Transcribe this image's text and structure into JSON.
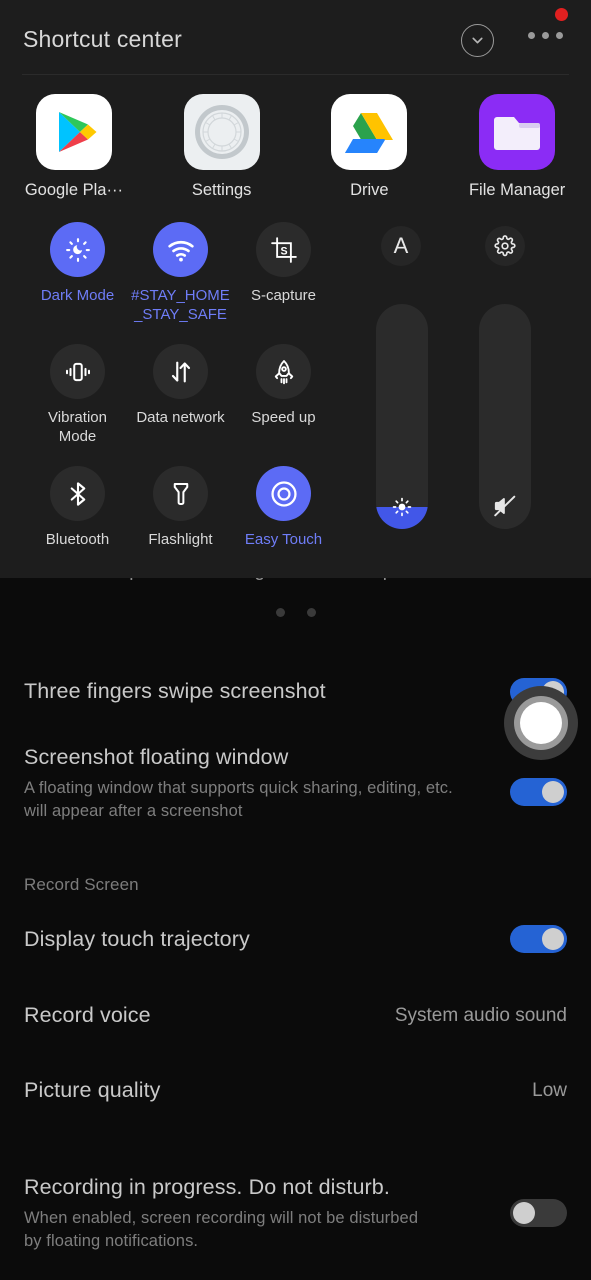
{
  "panel": {
    "title": "Shortcut center",
    "collapse_icon": "chevron-down-icon",
    "more_icon": "more-options-icon",
    "recording_indicator": "recording-dot",
    "apps": [
      {
        "label": "Google Pla···",
        "icon": "google-play-icon"
      },
      {
        "label": "Settings",
        "icon": "settings-gear-icon"
      },
      {
        "label": "Drive",
        "icon": "google-drive-icon"
      },
      {
        "label": "File Manager",
        "icon": "file-manager-folder-icon"
      }
    ],
    "tiles": [
      {
        "label": "Dark Mode",
        "icon": "dark-mode-icon",
        "active": true
      },
      {
        "label": "#STAY_HOME\n_STAY_SAFE",
        "icon": "wifi-icon",
        "active": true
      },
      {
        "label": "S-capture",
        "icon": "s-capture-crop-icon",
        "active": false
      },
      {
        "label": "Vibration\nMode",
        "icon": "vibration-icon",
        "active": false
      },
      {
        "label": "Data network",
        "icon": "data-network-arrows-icon",
        "active": false
      },
      {
        "label": "Speed up",
        "icon": "rocket-icon",
        "active": false
      },
      {
        "label": "Bluetooth",
        "icon": "bluetooth-icon",
        "active": false
      },
      {
        "label": "Flashlight",
        "icon": "flashlight-icon",
        "active": false
      },
      {
        "label": "Easy Touch",
        "icon": "easy-touch-circle-icon",
        "active": true
      }
    ],
    "auto_brightness_button": "A",
    "settings_button_icon": "gear-icon",
    "brightness_slider": {
      "icon": "brightness-icon",
      "percent": 10
    },
    "volume_slider": {
      "icon": "volume-muted-icon",
      "percent": 0
    },
    "accent_color": "#5C6BF5",
    "panel_background": "#1D1D1D"
  },
  "page": {
    "hint": "Slide up with three fingers to take a quick screenshot",
    "page_dots": 2,
    "rows": [
      {
        "title": "Three fingers swipe screenshot",
        "sub": "",
        "control": "toggle",
        "state": "on"
      },
      {
        "title": "Screenshot floating window",
        "sub": "A floating window that supports quick sharing, editing, etc. will appear after a screenshot",
        "control": "toggle",
        "state": "on"
      }
    ],
    "section_label": "Record Screen",
    "record_rows": [
      {
        "title": "Display touch trajectory",
        "sub": "",
        "control": "toggle",
        "state": "on"
      },
      {
        "title": "Record voice",
        "sub": "",
        "control": "value",
        "value": "System audio sound"
      },
      {
        "title": "Picture quality",
        "sub": "",
        "control": "value",
        "value": "Low"
      },
      {
        "title": "Recording in progress. Do not disturb.",
        "sub": "When enabled, screen recording will not be disturbed by floating notifications.",
        "control": "toggle",
        "state": "off"
      }
    ]
  },
  "colors": {
    "background": "#0B0B0B",
    "toggle_on": "#2563D4",
    "toggle_off": "#3A3A3A",
    "accent": "#5C6BF5",
    "record_red": "#E02020"
  }
}
